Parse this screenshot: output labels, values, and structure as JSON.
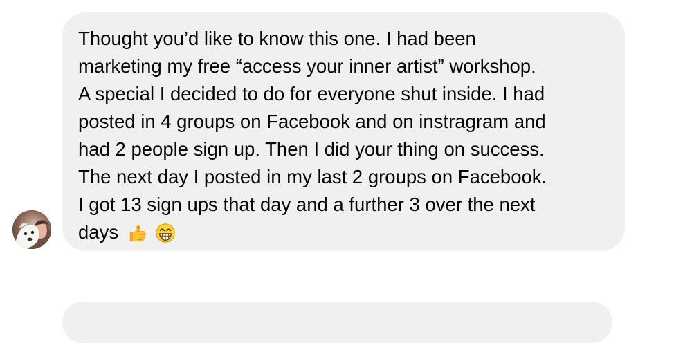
{
  "conversation": {
    "message": {
      "lines": [
        "Thought you’d like to know this one. I had been",
        "marketing my free “access your inner artist” workshop.",
        "A special I decided to do for everyone shut inside. I had",
        "posted in 4 groups on Facebook and on instragram and",
        "had 2 people sign up. Then I did your thing on success.",
        "The next day I posted in my last 2 groups on Facebook.",
        "I got 13 sign ups that day and a further 3 over the next",
        "days"
      ],
      "emoji_icons": [
        "thumbs-up-icon",
        "grinning-face-icon"
      ]
    }
  },
  "colors": {
    "background": "#ffffff",
    "bubble_background": "#f0f0f0",
    "text": "#050505"
  }
}
